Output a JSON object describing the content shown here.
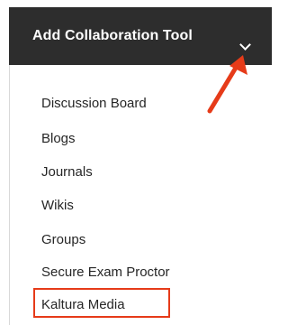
{
  "menu": {
    "button_label": "Add Collaboration Tool",
    "chevron_icon": "chevron-down-icon",
    "items": [
      {
        "label": "Discussion Board"
      },
      {
        "label": "Blogs"
      },
      {
        "label": "Journals"
      },
      {
        "label": "Wikis"
      },
      {
        "label": "Groups"
      },
      {
        "label": "Secure Exam Proctor"
      },
      {
        "label": "Kaltura Media",
        "highlighted": true
      }
    ]
  },
  "annotation": {
    "arrow_icon": "arrow-pointer-icon",
    "arrow_color": "#e63b19",
    "highlight_color": "#e63b19"
  },
  "colors": {
    "button_bg": "#2d2d2d",
    "button_text": "#ffffff",
    "item_text": "#262626"
  }
}
